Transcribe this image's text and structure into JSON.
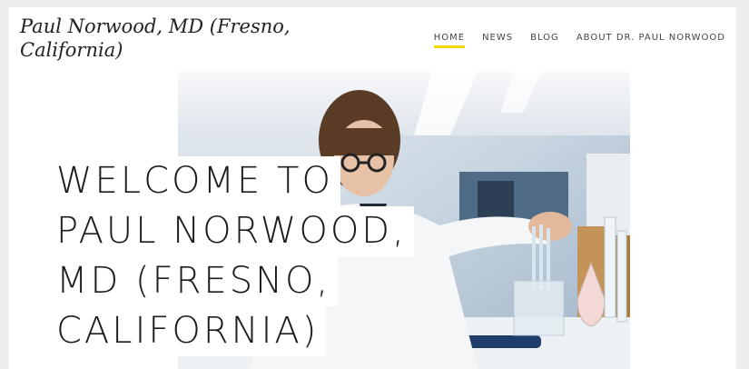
{
  "site": {
    "title": "Paul Norwood, MD (Fresno, California)"
  },
  "nav": {
    "items": [
      {
        "label": "HOME",
        "active": true
      },
      {
        "label": "NEWS"
      },
      {
        "label": "BLOG"
      },
      {
        "label": "ABOUT DR. PAUL NORWOOD"
      }
    ],
    "accent_color": "#f2d700"
  },
  "hero": {
    "headline_lines": [
      "WELCOME TO",
      "PAUL NORWOOD,",
      "MD (FRESNO,",
      "CALIFORNIA)"
    ]
  }
}
